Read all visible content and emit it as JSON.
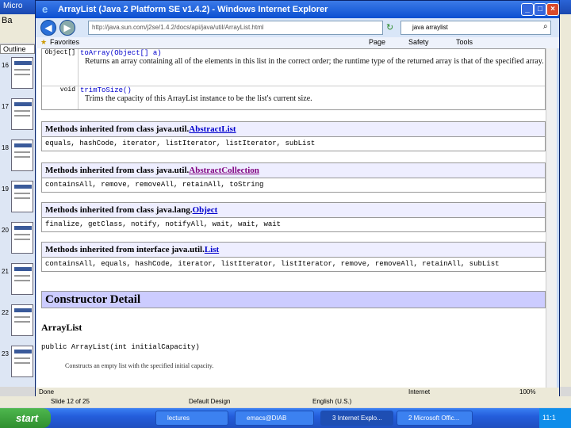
{
  "ppt": {
    "title": "Micro",
    "menu": "Ba",
    "outline_tab": "Outline",
    "slide_numbers": [
      "16",
      "17",
      "18",
      "19",
      "20",
      "21",
      "22",
      "23"
    ],
    "status_slide": "Slide 12 of 25",
    "status_design": "Default Design",
    "status_lang": "English (U.S.)"
  },
  "ie": {
    "title": "ArrayList (Java 2 Platform SE v1.4.2) - Windows Internet Explorer",
    "address": "http://java.sun.com/j2se/1.4.2/docs/api/java/util/ArrayList.html",
    "search": "java arraylist",
    "favorites": "Favorites",
    "toolbar_page": "Page",
    "toolbar_safety": "Safety",
    "toolbar_tools": "Tools",
    "status_done": "Done",
    "status_zone": "Internet",
    "status_zoom": "100%"
  },
  "doc": {
    "toArray": {
      "type": "Object[]",
      "sig": "toArray(Object[] a)",
      "desc": "Returns an array containing all of the elements in this list in the correct order; the runtime type of the returned array is that of the specified array."
    },
    "trimToSize": {
      "type": "void",
      "sig": "trimToSize()",
      "desc": "Trims the capacity of this ArrayList instance to be the list's current size."
    },
    "inherited": [
      {
        "prefix": "Methods inherited from class java.util.",
        "link": "AbstractList",
        "link_color": "#0000cc",
        "methods": "equals, hashCode, iterator, listIterator, listIterator, subList"
      },
      {
        "prefix": "Methods inherited from class java.util.",
        "link": "AbstractCollection",
        "link_color": "#800080",
        "methods": "containsAll, remove, removeAll, retainAll, toString"
      },
      {
        "prefix": "Methods inherited from class java.lang.",
        "link": "Object",
        "link_color": "#0000cc",
        "methods": "finalize, getClass, notify, notifyAll, wait, wait, wait"
      },
      {
        "prefix": "Methods inherited from interface java.util.",
        "link": "List",
        "link_color": "#0000cc",
        "methods": "containsAll, equals, hashCode, iterator, listIterator, listIterator, remove, removeAll, retainAll, subList"
      }
    ],
    "ctor_heading": "Constructor Detail",
    "ctor_name": "ArrayList",
    "ctor_sig": "public ArrayList(int initialCapacity)",
    "ctor_desc": "Constructs an empty list with the specified initial capacity."
  },
  "taskbar": {
    "start": "start",
    "tasks": [
      "lectures",
      "emacs@DIAB",
      "3 Internet Explo...",
      "2 Microsoft Offic..."
    ],
    "clock": "11:1"
  }
}
